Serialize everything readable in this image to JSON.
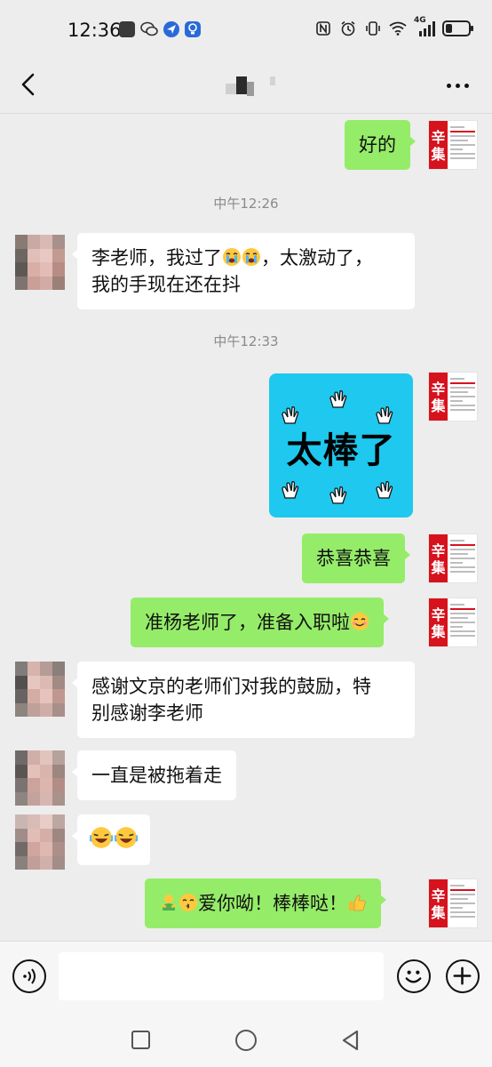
{
  "status_bar": {
    "time": "12:36",
    "network_label": "4G",
    "icons": [
      "notification-app-icon",
      "wechat-icon",
      "navigation-icon",
      "bulb-icon",
      "nfc-icon",
      "alarm-icon",
      "vibrate-icon",
      "wifi-icon",
      "signal-icon",
      "battery-icon"
    ],
    "battery_level": 0.3
  },
  "nav": {
    "title": "",
    "back_icon": "chevron-left-icon",
    "more_icon": "more-dots-icon"
  },
  "messages": [
    {
      "sender": "me",
      "text": "好的"
    },
    {
      "type": "timestamp",
      "text": "中午12:26"
    },
    {
      "sender": "other",
      "text_line1_a": "李老师，我过了",
      "emoji": "crying-emoji",
      "text_line1_b": "，太激动了，",
      "text_line2": "我的手现在还在抖"
    },
    {
      "type": "timestamp",
      "text": "中午12:33"
    },
    {
      "sender": "me",
      "type": "sticker",
      "text": "太棒了",
      "icon": "clapping-hands-icon"
    },
    {
      "sender": "me",
      "text": "恭喜恭喜"
    },
    {
      "sender": "me",
      "text": "准杨老师了，准备入职啦",
      "emoji": "smiling-emoji"
    },
    {
      "sender": "other",
      "text_line1": "感谢文京的老师们对我的鼓励，特",
      "text_line2": "别感谢李老师"
    },
    {
      "sender": "other",
      "text": "一直是被拖着走"
    },
    {
      "sender": "other",
      "type": "emoji",
      "emoji": "laughing-tears-emoji"
    },
    {
      "sender": "me",
      "text": "爱你呦！棒棒哒！",
      "emoji_before": [
        "hug-emoji",
        "kiss-emoji"
      ],
      "emoji_after": "thumbs-up-emoji"
    }
  ],
  "my_avatar": {
    "big_text_1": "辛",
    "big_text_2": "集"
  },
  "input_bar": {
    "value": "",
    "placeholder": "",
    "voice_icon": "voice-icon",
    "emoji_icon": "emoji-icon",
    "plus_icon": "plus-icon"
  },
  "system_nav": {
    "icons": [
      "recent-apps-icon",
      "home-icon",
      "back-icon"
    ]
  },
  "colors": {
    "my_bubble": "#95ec69",
    "other_bubble": "#ffffff",
    "background": "#ededed",
    "sticker_bg": "#1ec8ee",
    "avatar_red": "#d6121d"
  }
}
